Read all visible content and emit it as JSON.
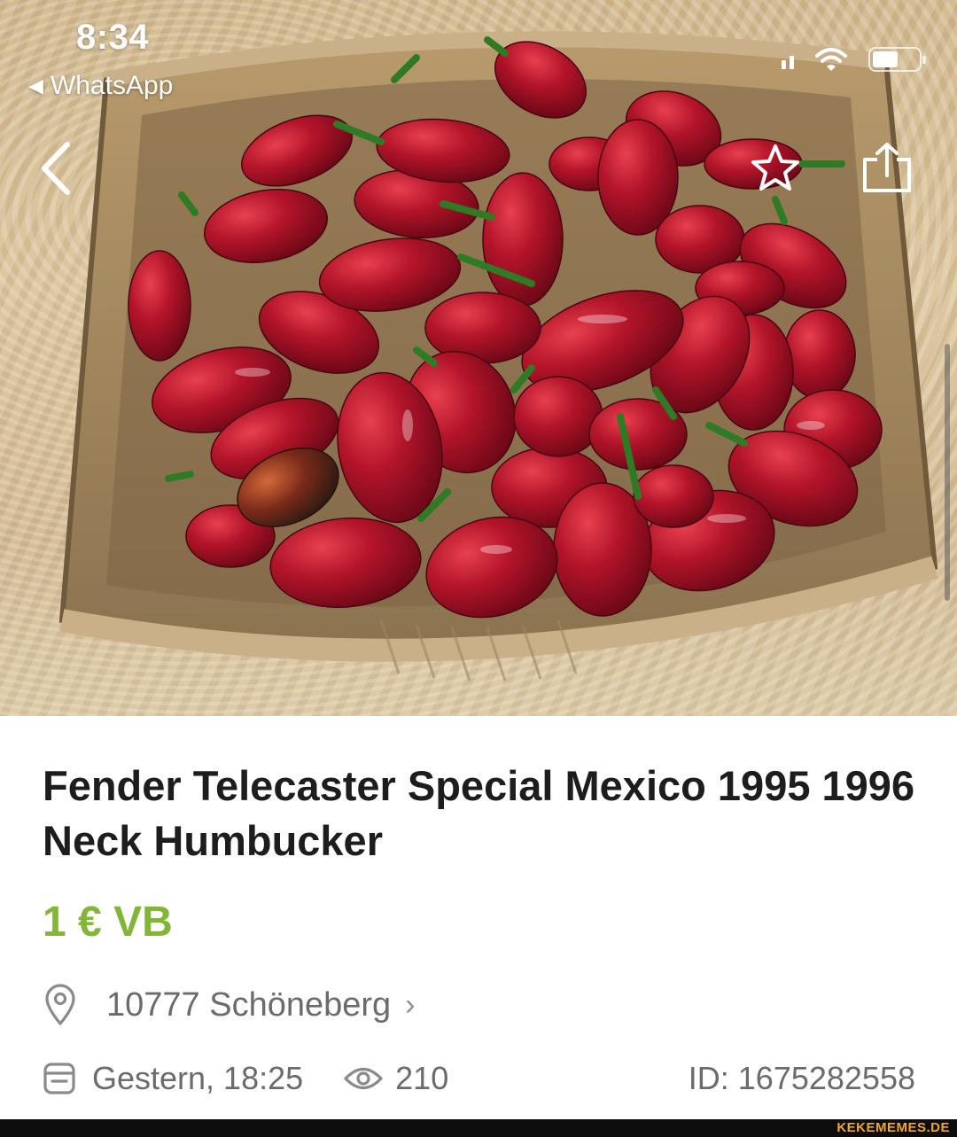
{
  "status_bar": {
    "time": "8:34",
    "back_app": "WhatsApp",
    "back_arrow": "◀",
    "battery_level": 0.55
  },
  "nav": {
    "back_icon": "chevron-left-icon",
    "favorite_icon": "star-icon",
    "share_icon": "share-icon"
  },
  "listing": {
    "title": "Fender Telecaster Special Mexico 1995 1996 Neck Humbucker",
    "price": "1 € VB",
    "location": "10777 Schöneberg",
    "location_chevron": "›",
    "date": "Gestern, 18:25",
    "views": "210",
    "id": "ID: 1675282558"
  },
  "colors": {
    "price_green": "#82b637",
    "secondary_text": "#6b6b6b",
    "title_text": "#1d1d1f",
    "watermark": "#f5a623"
  },
  "watermark": "KEKEMEMES.DE"
}
